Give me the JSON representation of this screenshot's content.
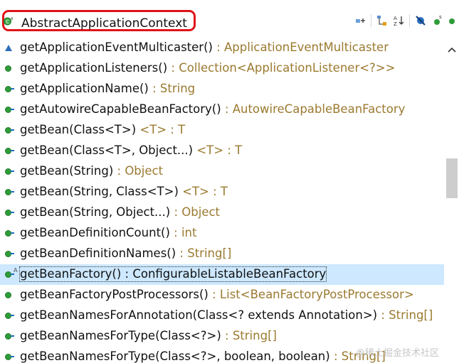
{
  "header": {
    "title": "AbstractApplicationContext",
    "class_icon": "class-green-icon"
  },
  "toolbar": {
    "icons": [
      "expand-members-icon",
      "hide-fields-icon",
      "sort-icon",
      "hide-static-icon",
      "hide-nonpublic-icon",
      "more-icon"
    ]
  },
  "members": [
    {
      "visibility": "protected",
      "name": "getApplicationEventMulticaster()",
      "ret": " : ApplicationEventMulticaster"
    },
    {
      "visibility": "public",
      "name": "getApplicationListeners()",
      "ret": " : Collection<ApplicationListener<?>>"
    },
    {
      "visibility": "public-override",
      "name": "getApplicationName()",
      "ret": " : String"
    },
    {
      "visibility": "public-override",
      "name": "getAutowireCapableBeanFactory()",
      "ret": " : AutowireCapableBeanFactory"
    },
    {
      "visibility": "public-override",
      "name": "getBean(Class<T>)",
      "ret": " <T> : T"
    },
    {
      "visibility": "public-override",
      "name": "getBean(Class<T>, Object...)",
      "ret": " <T> : T"
    },
    {
      "visibility": "public-override",
      "name": "getBean(String)",
      "ret": " : Object"
    },
    {
      "visibility": "public-override",
      "name": "getBean(String, Class<T>)",
      "ret": " <T> : T"
    },
    {
      "visibility": "public-override",
      "name": "getBean(String, Object...)",
      "ret": " : Object"
    },
    {
      "visibility": "public-override",
      "name": "getBeanDefinitionCount()",
      "ret": " : int"
    },
    {
      "visibility": "public-override",
      "name": "getBeanDefinitionNames()",
      "ret": " : String[]"
    },
    {
      "visibility": "public-abstract",
      "name": "getBeanFactory() : ConfigurableListableBeanFactory",
      "ret": "",
      "selected": true
    },
    {
      "visibility": "public",
      "name": "getBeanFactoryPostProcessors()",
      "ret": " : List<BeanFactoryPostProcessor>"
    },
    {
      "visibility": "public-override",
      "name": "getBeanNamesForAnnotation(Class<? extends Annotation>)",
      "ret": " : String[]"
    },
    {
      "visibility": "public-override",
      "name": "getBeanNamesForType(Class<?>)",
      "ret": " : String[]"
    },
    {
      "visibility": "public-override",
      "name": "getBeanNamesForType(Class<?>, boolean, boolean)",
      "ret": " : String[]"
    }
  ],
  "watermark": "@稀土掘金技术社区",
  "colors": {
    "highlight_border": "#e0131a",
    "selection": "#cde8ff",
    "return_type": "#9b7a30",
    "public_dot": "#2e9c3a"
  }
}
